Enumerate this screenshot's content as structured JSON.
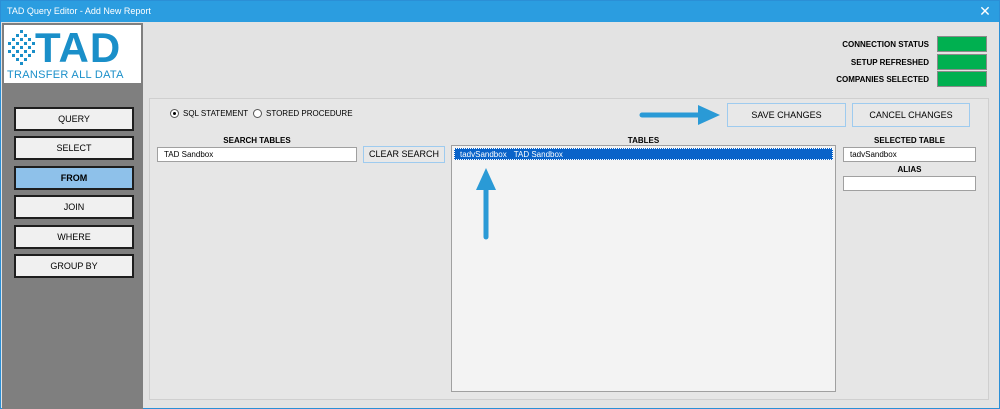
{
  "window": {
    "title": "TAD Query Editor - Add New Report",
    "close_glyph": "✕"
  },
  "logo": {
    "big": "TAD",
    "sub": "TRANSFER ALL DATA"
  },
  "nav": [
    {
      "label": "QUERY"
    },
    {
      "label": "SELECT"
    },
    {
      "label": "FROM"
    },
    {
      "label": "JOIN"
    },
    {
      "label": "WHERE"
    },
    {
      "label": "GROUP BY"
    }
  ],
  "status": {
    "connection": "CONNECTION STATUS",
    "setup": "SETUP REFRESHED",
    "companies": "COMPANIES SELECTED",
    "indicator_color": "#00b050"
  },
  "source": {
    "sql": "SQL STATEMENT",
    "stored": "STORED PROCEDURE",
    "selected": "SQL STATEMENT"
  },
  "search": {
    "label": "SEARCH TABLES",
    "value": "TAD Sandbox",
    "clear_label": "CLEAR SEARCH"
  },
  "tables": {
    "label": "TABLES",
    "rows": [
      {
        "name": "tadvSandbox",
        "desc": "TAD Sandbox",
        "selected": true
      }
    ]
  },
  "actions": {
    "save": "SAVE CHANGES",
    "cancel": "CANCEL CHANGES"
  },
  "selected_table": {
    "label": "SELECTED TABLE",
    "value": "tadvSandbox"
  },
  "alias": {
    "label": "ALIAS",
    "value": ""
  },
  "colors": {
    "titlebar": "#2b9de0",
    "accent_arrow": "#2a9ad6",
    "selection": "#0a63c9"
  }
}
